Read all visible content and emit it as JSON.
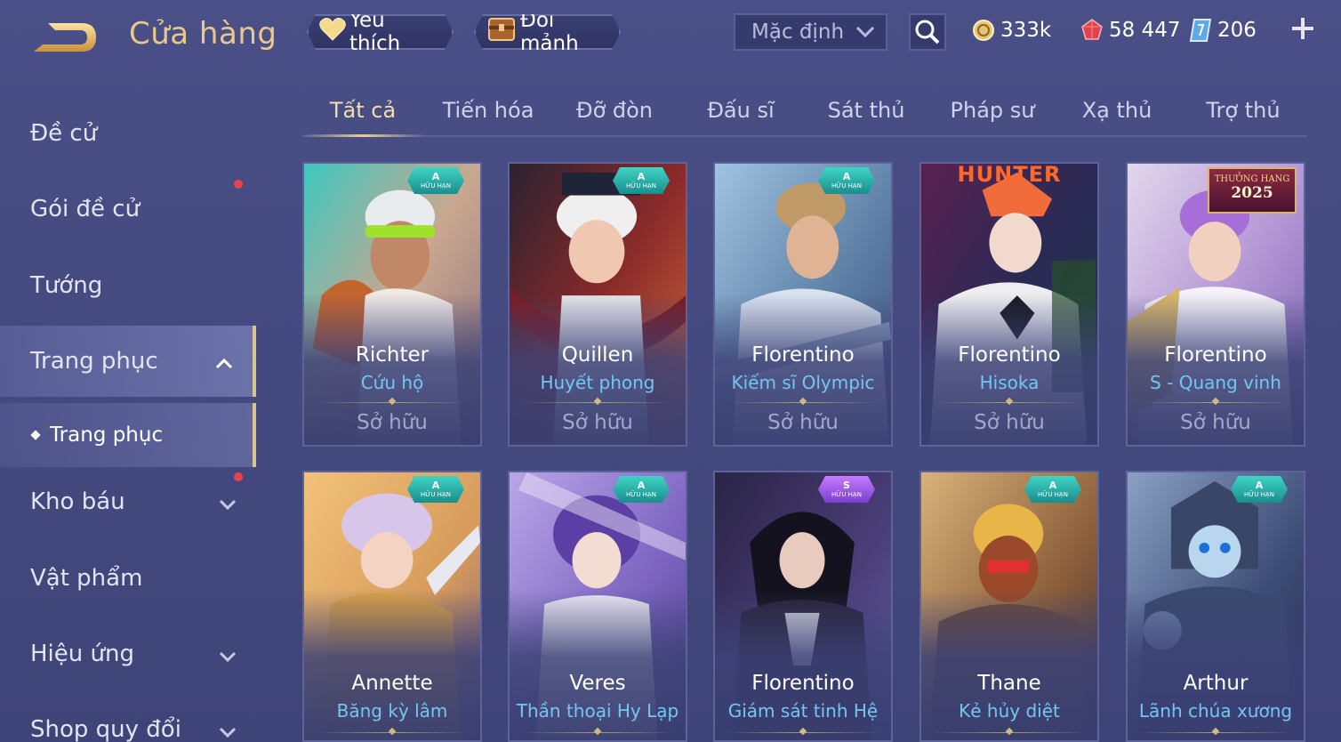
{
  "header": {
    "title": "Cửa hàng",
    "favorite_label": "Yêu thích",
    "exchange_label": "Đổi mảnh",
    "sort_value": "Mặc định",
    "currencies": {
      "gold": "333k",
      "ruby": "58 447",
      "voucher": "206"
    }
  },
  "sidebar": {
    "items": [
      {
        "label": "Đề cử"
      },
      {
        "label": "Gói đề cử"
      },
      {
        "label": "Tướng"
      },
      {
        "label": "Trang phục"
      },
      {
        "label": "Trang phục"
      },
      {
        "label": "Kho báu"
      },
      {
        "label": "Vật phẩm"
      },
      {
        "label": "Hiệu ứng"
      },
      {
        "label": "Shop quy đổi"
      }
    ]
  },
  "tabs": [
    "Tất cả",
    "Tiến hóa",
    "Đỡ đòn",
    "Đấu sĩ",
    "Sát thủ",
    "Pháp sư",
    "Xạ thủ",
    "Trợ thủ"
  ],
  "cards": [
    {
      "hero": "Richter",
      "skin": "Cứu hộ",
      "status": "Sở hữu",
      "tier": "A",
      "limited": "HỮU HẠN"
    },
    {
      "hero": "Quillen",
      "skin": "Huyết phong",
      "status": "Sở hữu",
      "tier": "A",
      "limited": "HỮU HẠN"
    },
    {
      "hero": "Florentino",
      "skin": "Kiếm sĩ Olympic",
      "status": "Sở hữu",
      "tier": "A",
      "limited": "HỮU HẠN"
    },
    {
      "hero": "Florentino",
      "skin": "Hisoka",
      "status": "Sở hữu",
      "logo": "HUNTER"
    },
    {
      "hero": "Florentino",
      "skin": "S - Quang vinh",
      "status": "Sở hữu",
      "ranked_line1": "THƯỞNG HẠNG",
      "ranked_line2": "2025"
    },
    {
      "hero": "Annette",
      "skin": "Băng kỳ lâm",
      "tier": "A",
      "limited": "HỮU HẠN"
    },
    {
      "hero": "Veres",
      "skin": "Thần thoại Hy Lạp",
      "tier": "A",
      "limited": "HỮU HẠN"
    },
    {
      "hero": "Florentino",
      "skin": "Giám sát tinh Hệ",
      "tier": "S",
      "limited": "HỮU HẠN"
    },
    {
      "hero": "Thane",
      "skin": "Kẻ hủy diệt",
      "tier": "A",
      "limited": "HỮU HẠN"
    },
    {
      "hero": "Arthur",
      "skin": "Lãnh chúa xương",
      "tier": "A",
      "limited": "HỮU HẠN"
    }
  ],
  "colors": {
    "accent_gold": "#e9c98a",
    "skin_name": "#74c6f2",
    "notification": "#e8434b"
  }
}
